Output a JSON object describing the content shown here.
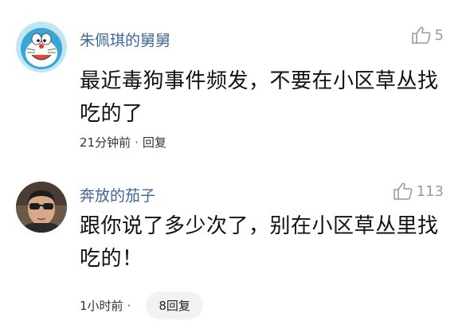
{
  "comments": [
    {
      "username": "朱佩琪的舅舅",
      "likes": "5",
      "content": "最近毒狗事件频发，不要在小区草丛找吃的了",
      "time": "21分钟前",
      "separator": "·",
      "reply_label": "回复",
      "avatar_icon": "doraemon-avatar-icon"
    },
    {
      "username": "奔放的茄子",
      "likes": "113",
      "content": "跟你说了多少次了，别在小区草丛里找吃的！",
      "time": "1小时前",
      "separator": "·",
      "reply_label": "8回复",
      "avatar_icon": "man-sunglasses-avatar-icon"
    }
  ],
  "colors": {
    "username": "#406599",
    "like": "#9a9a9a",
    "reply_pill_bg": "#f2f2f2"
  }
}
